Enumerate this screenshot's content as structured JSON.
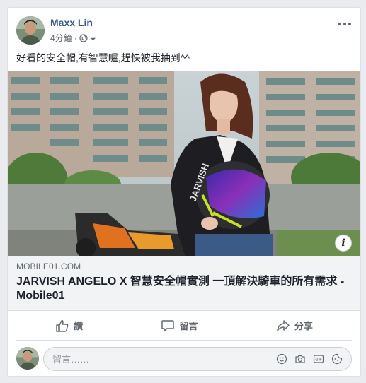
{
  "post": {
    "author": "Maxx Lin",
    "time": "4分鐘",
    "text": "好看的安全帽,有智慧喔,趕快被我抽到^^"
  },
  "link": {
    "domain": "MOBILE01.COM",
    "title": "JARVISH ANGELO X 智慧安全帽實測 一頂解決騎車的所有需求 - Mobile01",
    "info_glyph": "i",
    "image_text": "JARVISH"
  },
  "actions": {
    "like": "讚",
    "comment": "留言",
    "share": "分享"
  },
  "comment_box": {
    "placeholder": "留言……"
  },
  "icons": {
    "privacy": "globe-icon",
    "more": "more-options-icon",
    "like": "thumbs-up-icon",
    "comment": "speech-bubble-icon",
    "share": "share-arrow-icon",
    "emoji": "smiley-icon",
    "camera": "camera-icon",
    "gif": "gif-icon",
    "sticker": "sticker-icon"
  },
  "colors": {
    "author_link": "#385898",
    "meta_text": "#616770",
    "background": "#e9ebee"
  }
}
